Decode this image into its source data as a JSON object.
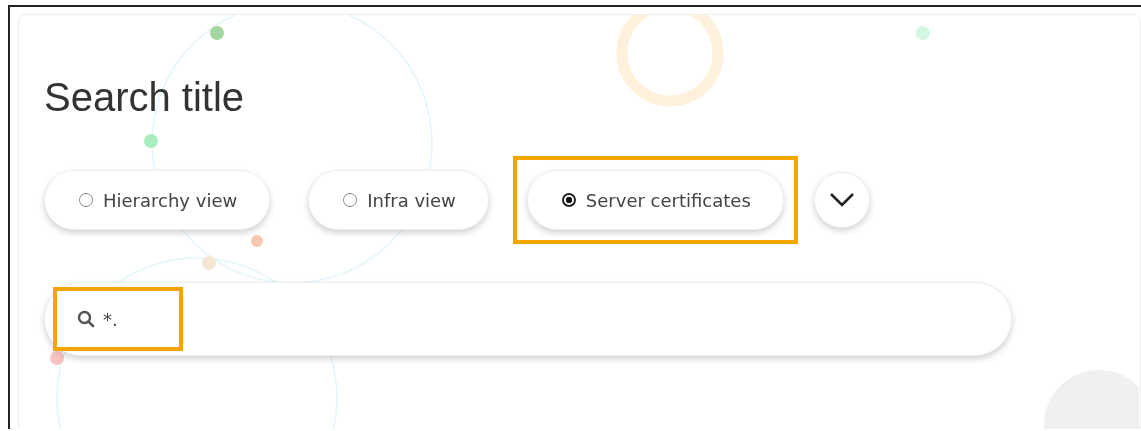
{
  "title": "Search title",
  "options": [
    {
      "label": "Hierarchy view",
      "selected": false,
      "highlighted": false
    },
    {
      "label": "Infra view",
      "selected": false,
      "highlighted": false
    },
    {
      "label": "Server certificates",
      "selected": true,
      "highlighted": true
    }
  ],
  "more_expanded": false,
  "search": {
    "value": "*.",
    "highlighted": true
  }
}
